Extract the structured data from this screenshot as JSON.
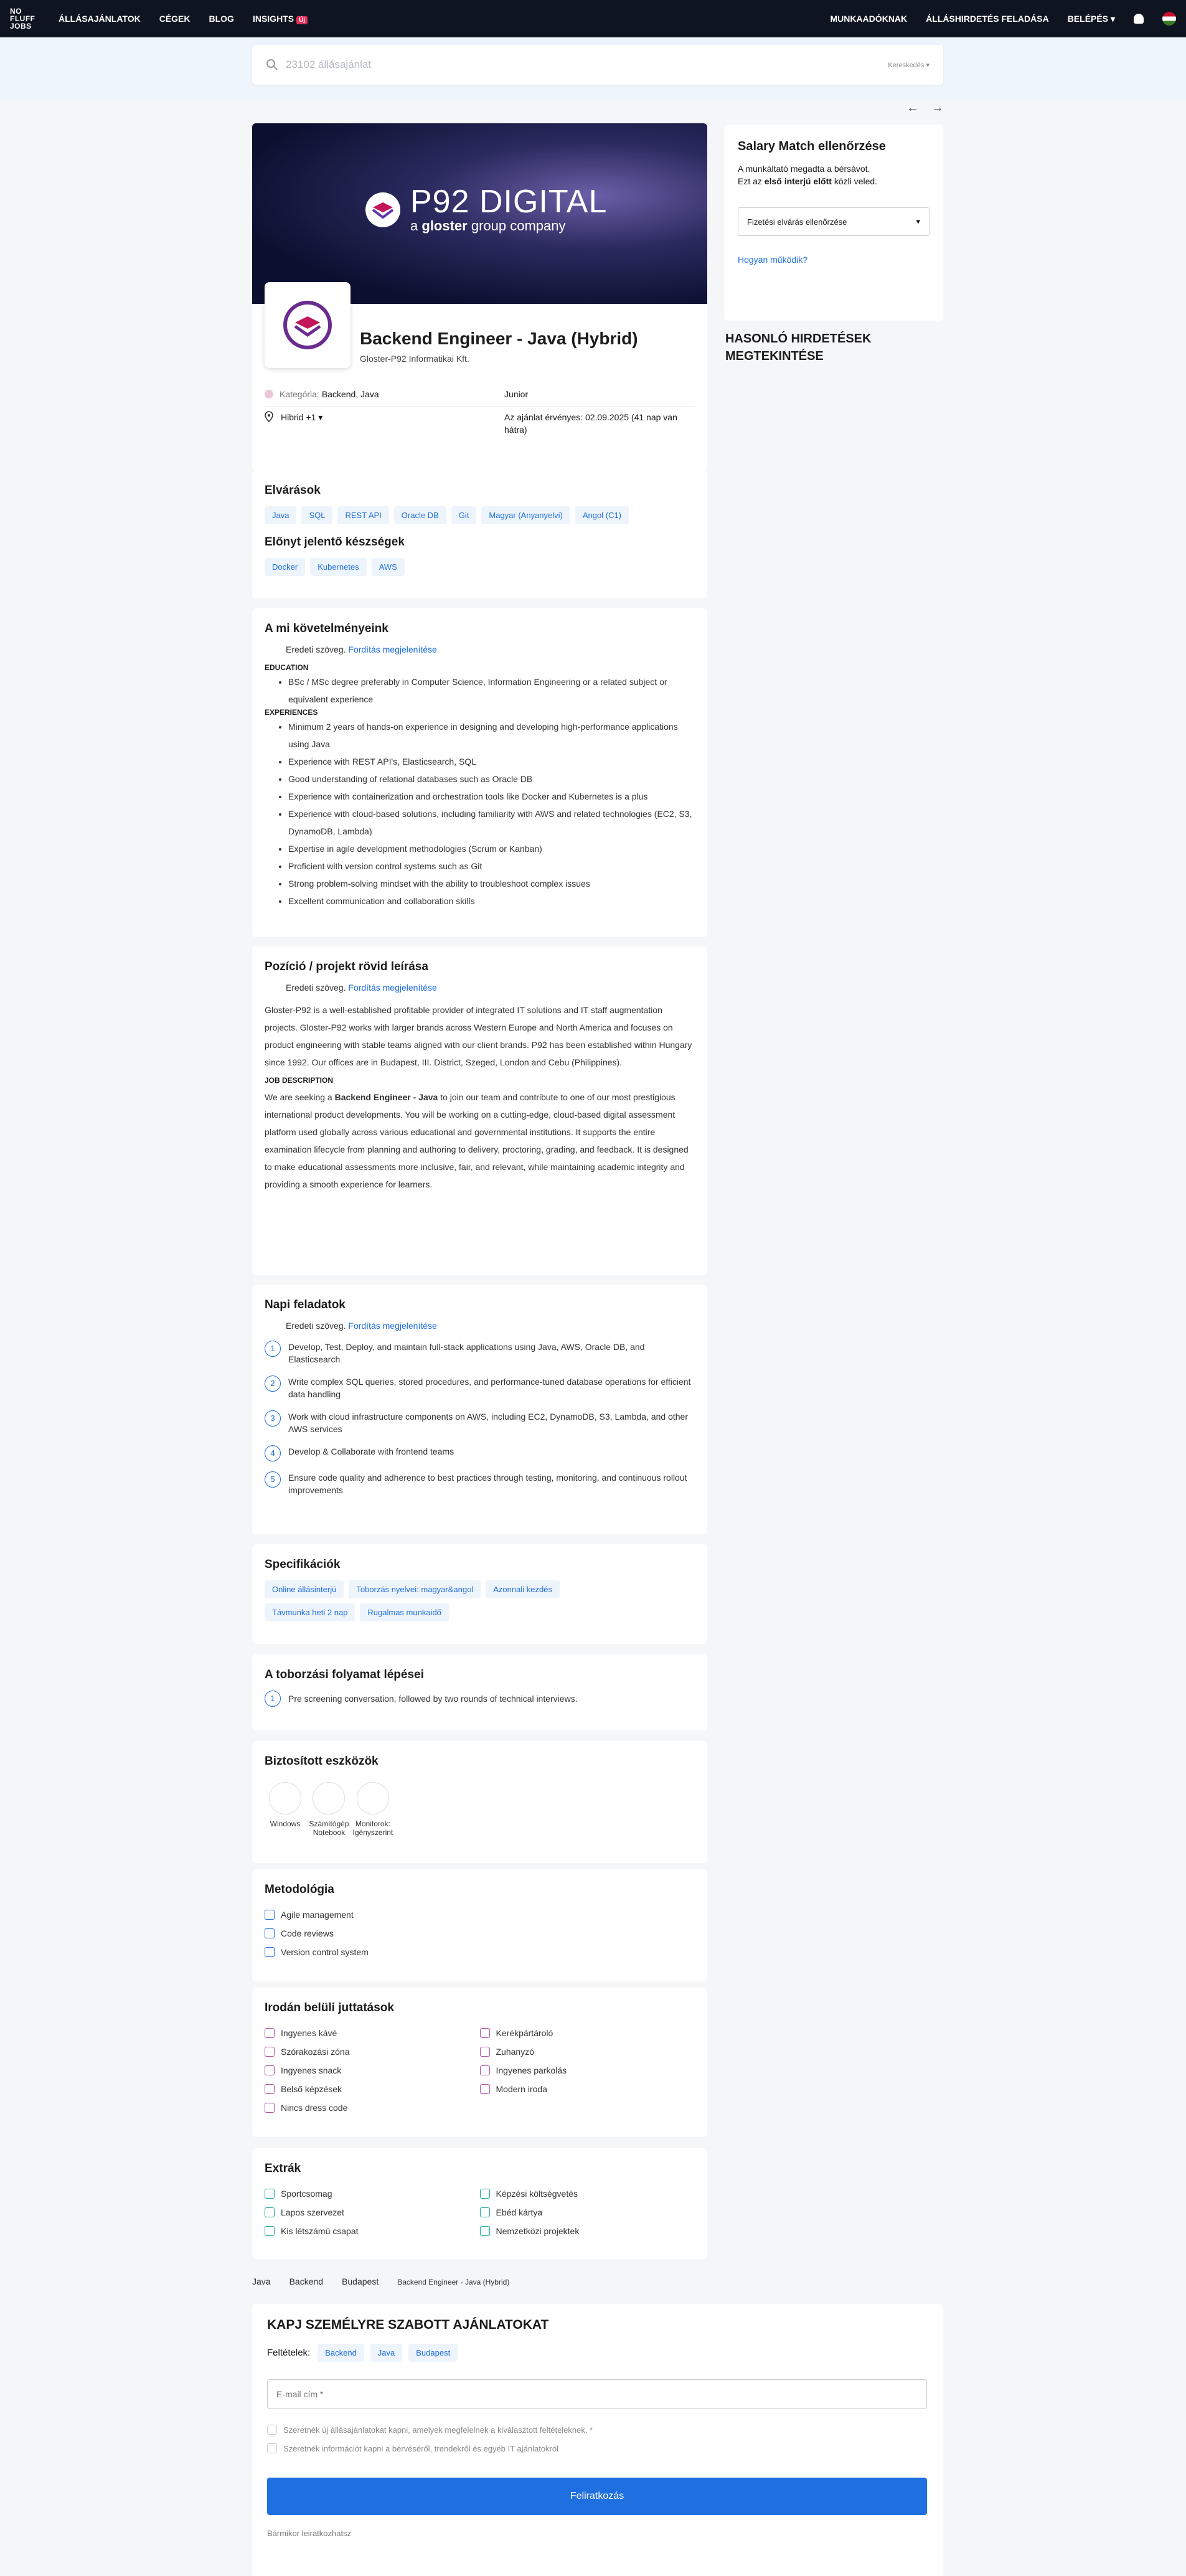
{
  "nav": {
    "logo": [
      "NO",
      "FLUFF",
      "JOBS"
    ],
    "links": [
      "ÁLLÁSAJÁNLATOK",
      "CÉGEK",
      "BLOG",
      "INSIGHTS"
    ],
    "insights_badge": "Új",
    "right": [
      "MUNKAADÓKNAK",
      "ÁLLÁSHIRDETÉS FELADÁSA",
      "BELÉPÉS"
    ]
  },
  "search": {
    "placeholder": "23102 állásajánlat",
    "sort": "Kereskedés"
  },
  "banner": {
    "brand": "P92 DIGITAL",
    "tag_a": "a",
    "tag_b": "gloster",
    "tag_c": "group company"
  },
  "job": {
    "title": "Backend Engineer - Java (Hybrid)",
    "company": "Gloster-P92 Informatikai Kft.",
    "category_label": "Kategória:",
    "category": "Backend, Java",
    "seniority": "Junior",
    "location": "Hibrid +1",
    "valid": "Az ajánlat érvényes: 02.09.2025 (41 nap van hátra)"
  },
  "skills": {
    "title": "Elvárások",
    "required": [
      "Java",
      "SQL",
      "REST API",
      "Oracle DB",
      "Git",
      "Magyar (Anyanyelvi)",
      "Angol (C1)"
    ],
    "nice_title": "Előnyt jelentő készségek",
    "nice": [
      "Docker",
      "Kubernetes",
      "AWS"
    ]
  },
  "original_text": "Eredeti szöveg.",
  "translate_link": "Fordítás megjelenítése",
  "requirements": {
    "title": "A mi követelményeink",
    "edu_head": "EDUCATION",
    "edu": [
      "BSc / MSc degree preferably in Computer Science, Information Engineering or a related subject or equivalent experience"
    ],
    "exp_head": "EXPERIENCES",
    "exp": [
      "Minimum 2 years of hands-on experience in designing and developing high-performance applications using Java",
      "Experience with REST API's, Elasticsearch, SQL",
      "Good understanding of relational databases such as Oracle DB",
      "Experience with containerization and orchestration tools like Docker and Kubernetes is a plus",
      "Experience with cloud-based solutions, including familiarity with AWS and related technologies (EC2, S3, DynamoDB, Lambda)",
      "Expertise in agile development methodologies (Scrum or Kanban)",
      "Proficient with version control systems such as Git",
      "Strong problem-solving mindset with the ability to troubleshoot complex issues",
      "Excellent communication and collaboration skills"
    ]
  },
  "project": {
    "title": "Pozíció / projekt rövid leírása",
    "p1": "Gloster-P92 is a well-established profitable provider of integrated IT solutions and IT staff augmentation projects. Gloster-P92 works with larger brands across Western Europe and North America and focuses on product engineering with stable teams aligned with our client brands. P92 has been established within Hungary since 1992. Our offices are in Budapest, III. District, Szeged, London and Cebu (Philippines).",
    "jd_head": "JOB DESCRIPTION",
    "p2a": "We are seeking a",
    "p2b": "Backend Engineer - Java",
    "p2c": "to join our team and contribute to one of our most prestigious international product developments. You will be working on a cutting-edge, cloud-based digital assessment platform used globally across various educational and governmental institutions. It supports the entire examination lifecycle from planning and authoring to delivery, proctoring, grading, and feedback. It is designed to make educational assessments more inclusive, fair, and relevant, while maintaining academic integrity and providing a smooth experience for learners."
  },
  "tasks": {
    "title": "Napi feladatok",
    "items": [
      "Develop, Test, Deploy, and maintain full-stack applications using Java, AWS, Oracle DB, and Elasticsearch",
      "Write complex SQL queries, stored procedures, and performance-tuned database operations for efficient data handling",
      "Work with cloud infrastructure components on AWS, including EC2, DynamoDB, S3, Lambda, and other AWS services",
      "Develop & Collaborate with frontend teams",
      "Ensure code quality and adherence to best practices through testing, monitoring, and continuous rollout improvements"
    ]
  },
  "specs": {
    "title": "Specifikációk",
    "items": [
      "Online állásinterjú",
      "Toborzás nyelvei: magyar&angol",
      "Azonnali kezdés",
      "Távmunka heti 2 nap",
      "Rugalmas munkaidő"
    ]
  },
  "recruit": {
    "title": "A toborzási folyamat lépései",
    "steps": [
      "Pre screening conversation, followed by two rounds of technical interviews."
    ]
  },
  "tools": {
    "title": "Biztosított eszközök",
    "items": [
      "Windows",
      "Számítógép Notebook",
      "Monitorok: Igényszerint"
    ]
  },
  "method": {
    "title": "Metodológia",
    "items": [
      "Agile management",
      "Code reviews",
      "Version control system"
    ]
  },
  "perks": {
    "title": "Irodán belüli juttatások",
    "left": [
      "Ingyenes kávé",
      "Szórakozási zóna",
      "Ingyenes snack",
      "Belső képzések",
      "Nincs dress code"
    ],
    "right": [
      "Kerékpártároló",
      "Zuhanyzó",
      "Ingyenes parkolás",
      "Modern iroda"
    ]
  },
  "extras": {
    "title": "Extrák",
    "left": [
      "Sportcsomag",
      "Lapos szervezet",
      "Kis létszámú csapat"
    ],
    "right": [
      "Képzési költségvetés",
      "Ebéd kártya",
      "Nemzetközi projektek"
    ]
  },
  "breadcrumb": [
    "Java",
    "Backend",
    "Budapest",
    "Backend Engineer - Java (Hybrid)"
  ],
  "sidebar": {
    "title": "Salary Match ellenőrzése",
    "line1": "A munkáltató megadta a bérsávot.",
    "line2a": "Ezt az",
    "line2b": "első interjú előtt",
    "line2c": "közli veled.",
    "select": "Fizetési elvárás ellenőrzése",
    "how": "Hogyan működik?",
    "similar": "HASONLÓ HIRDETÉSEK MEGTEKINTÉSE"
  },
  "subscribe": {
    "title": "KAPJ SZEMÉLYRE SZABOTT AJÁNLATOKAT",
    "cond_label": "Feltételek:",
    "conds": [
      "Backend",
      "Java",
      "Budapest"
    ],
    "email_placeholder": "E-mail cím *",
    "check1": "Szeretnék új állásajánlatokat kapni, amelyek megfelelnek a kiválasztott feltételeknek. *",
    "check2": "Szeretnék információt kapni a bérvéséről, trendekről és egyéb IT ajánlatokról",
    "button": "Feliratkozás",
    "footnote": "Bármikor leiratkozhatsz"
  },
  "colors": {
    "accent": "#1e6fe0",
    "nav": "#0e1520",
    "perk": "#b04fa5",
    "extra": "#17a89a"
  }
}
